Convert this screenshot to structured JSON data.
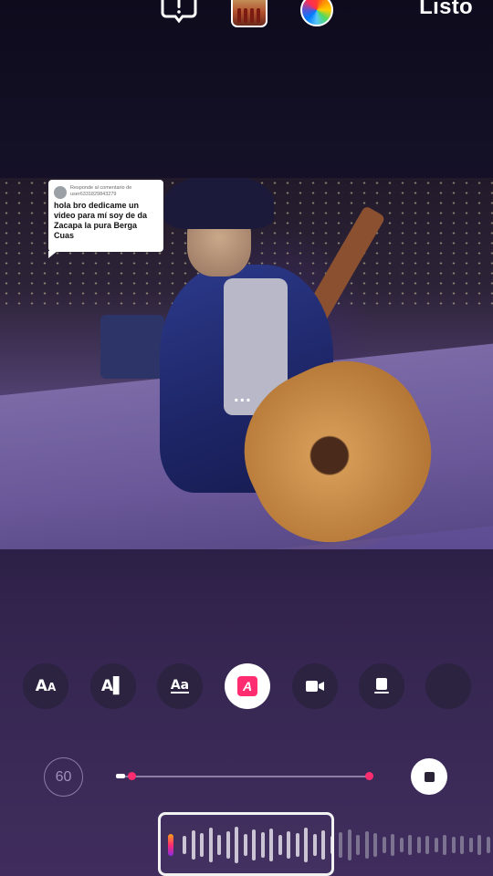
{
  "header": {
    "done_label": "Listo",
    "icons": [
      "alert-icon",
      "sticker-thumbnail",
      "color-wheel-icon"
    ]
  },
  "video": {
    "comment_reply": {
      "reply_meta": "Responde al comentario de user6331829843279",
      "comment": "hola bro dedicame un video para mí soy de da Zacapa la pura Berga Cuas"
    },
    "more_label": "..."
  },
  "tools": [
    {
      "name": "font-size-tool",
      "glyph": "Aa"
    },
    {
      "name": "text-align-tool",
      "glyph": "A|"
    },
    {
      "name": "text-style-tool",
      "glyph": "Aa"
    },
    {
      "name": "text-effect-tool",
      "glyph": "A"
    },
    {
      "name": "camera-tool",
      "glyph": "▮"
    },
    {
      "name": "caption-box-tool",
      "glyph": "▀"
    },
    {
      "name": "extra-tool",
      "glyph": ""
    }
  ],
  "audio": {
    "duration": "60",
    "trim_start_fraction": 0.06,
    "trim_end_fraction": 0.99
  },
  "colors": {
    "accent": "#ff2d6f"
  }
}
